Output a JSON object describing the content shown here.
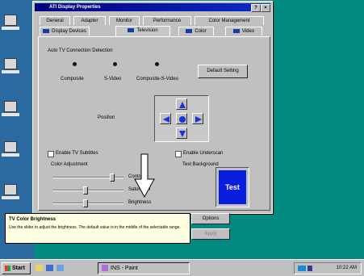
{
  "window": {
    "title": "ATI Display Properties"
  },
  "tabs_row1": [
    "General",
    "Adapter",
    "Monitor",
    "Performance",
    "Color Management"
  ],
  "tabs_row2": [
    "Display Devices",
    "Television",
    "Color",
    "Video"
  ],
  "tv": {
    "auto_detect_label": "Auto TV Connection Detection",
    "connectors": [
      "Composite",
      "S-Video",
      "Composite-S-Video"
    ],
    "default_button": "Default Setting",
    "position_label": "Position",
    "enable_subtitles": "Enable TV Subtitles",
    "enable_underscan": "Enable Underscan",
    "color_adjustment": "Color Adjustment",
    "sliders": [
      {
        "label": "Contrast",
        "value": 0.85
      },
      {
        "label": "Saturation",
        "value": 0.45
      },
      {
        "label": "Brightness",
        "value": 0.45
      }
    ],
    "test_background_label": "Test Background",
    "test_text": "Test",
    "options_button": "Options",
    "apply_button": "Apply"
  },
  "tooltip": {
    "title": "TV Color Brightness",
    "body": "Use the slider to adjust the brightness. The default value is in the middle of the selectable range."
  },
  "taskbar": {
    "start_label": "Start",
    "task_button": "INS - Paint",
    "clock": "10:22 AM"
  },
  "colors": {
    "desktop": "#008a82",
    "title_bar": "#00007b",
    "arrow_blue": "#1734d8",
    "test_bg": "#0a1ee0",
    "tooltip_bg": "#ffffe1"
  },
  "icons": [
    "help-icon",
    "close-icon",
    "tab-icon",
    "arrow-up-icon",
    "arrow-down-icon",
    "arrow-left-icon",
    "arrow-right-icon",
    "center-dot-icon",
    "mouse-cursor-icon",
    "windows-logo-icon",
    "paint-icon",
    "tray-monitor-icon"
  ]
}
